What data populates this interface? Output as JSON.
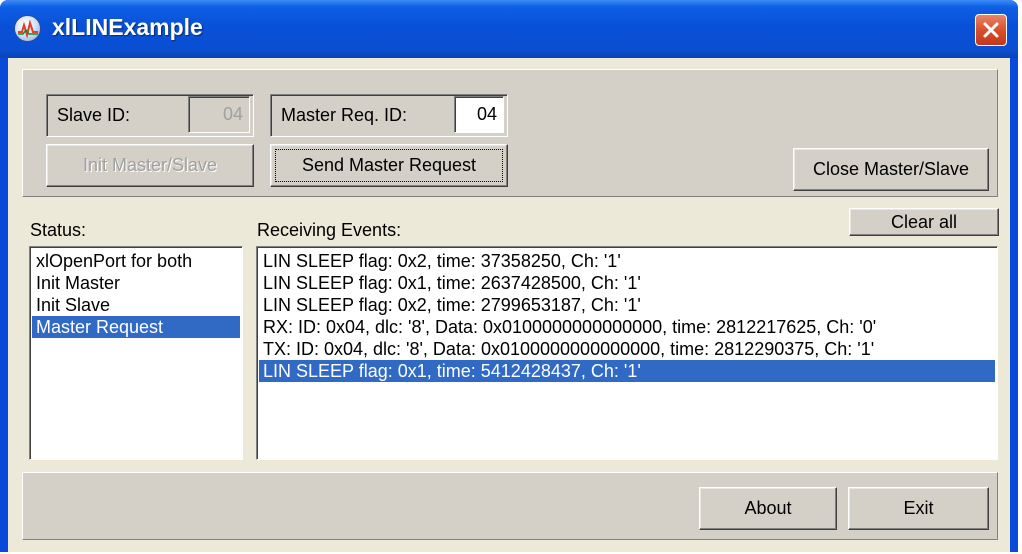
{
  "window": {
    "title": "xlLINExample"
  },
  "top_panel": {
    "slave_id_label": "Slave ID:",
    "slave_id_value": "04",
    "master_req_label": "Master Req. ID:",
    "master_req_value": "04",
    "init_button": "Init Master/Slave",
    "send_button": "Send Master Request",
    "close_button": "Close Master/Slave"
  },
  "status": {
    "label": "Status:",
    "items": [
      {
        "text": "xlOpenPort for both",
        "selected": false
      },
      {
        "text": "Init Master",
        "selected": false
      },
      {
        "text": "Init Slave",
        "selected": false
      },
      {
        "text": "Master Request",
        "selected": true
      }
    ]
  },
  "events": {
    "label": "Receiving Events:",
    "clear_button": "Clear all",
    "items": [
      {
        "text": "LIN SLEEP flag: 0x2, time: 37358250, Ch: '1'",
        "selected": false
      },
      {
        "text": "LIN SLEEP flag: 0x1, time: 2637428500, Ch: '1'",
        "selected": false
      },
      {
        "text": "LIN SLEEP flag: 0x2, time: 2799653187, Ch: '1'",
        "selected": false
      },
      {
        "text": "RX: ID: 0x04, dlc: '8', Data: 0x0100000000000000, time: 2812217625, Ch: '0'",
        "selected": false
      },
      {
        "text": "TX: ID: 0x04, dlc: '8', Data: 0x0100000000000000, time: 2812290375, Ch: '1'",
        "selected": false
      },
      {
        "text": "LIN SLEEP flag: 0x1, time: 5412428437, Ch: '1'",
        "selected": true
      }
    ]
  },
  "bottom_panel": {
    "about_button": "About",
    "exit_button": "Exit"
  },
  "colors": {
    "titlebar": "#0a50d8",
    "selection": "#316ac5",
    "panel": "#d4d0c8"
  }
}
